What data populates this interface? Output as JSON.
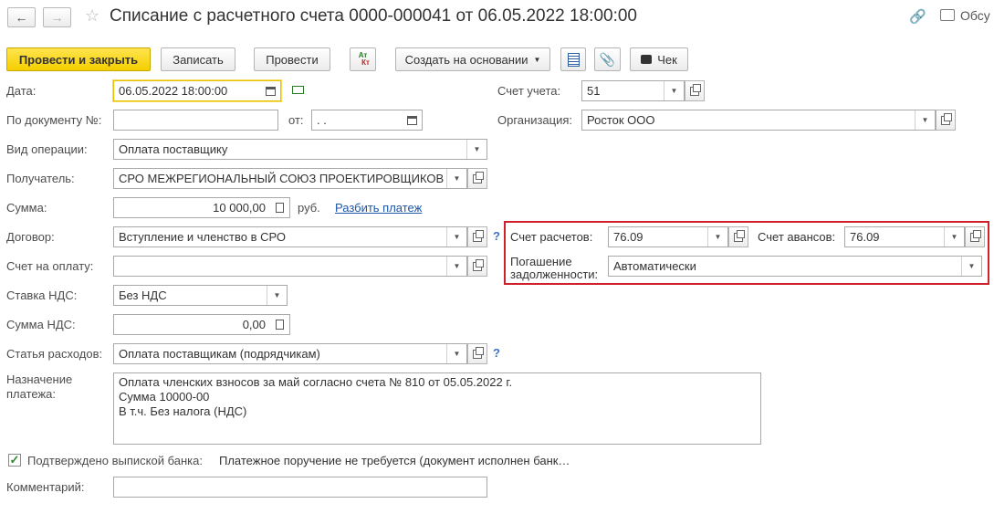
{
  "window": {
    "title": "Списание с расчетного счета 0000-000041 от 06.05.2022 18:00:00",
    "discuss_label": "Обсу"
  },
  "toolbar": {
    "post_close": "Провести и закрыть",
    "save": "Записать",
    "post": "Провести",
    "dtkt_top": "Ат",
    "dtkt_bottom": "Кт",
    "create_based": "Создать на основании",
    "check": "Чек"
  },
  "form": {
    "date_label": "Дата:",
    "date_value": "06.05.2022 18:00:00",
    "doc_no_label": "По документу №:",
    "doc_no_value": "",
    "from_label": "от:",
    "from_value": " .  .",
    "op_type_label": "Вид операции:",
    "op_type_value": "Оплата поставщику",
    "recipient_label": "Получатель:",
    "recipient_value": "СРО МЕЖРЕГИОНАЛЬНЫЙ СОЮЗ ПРОЕКТИРОВЩИКОВ",
    "sum_label": "Сумма:",
    "sum_value": "10 000,00",
    "currency": "руб.",
    "split_link": "Разбить платеж",
    "contract_label": "Договор:",
    "contract_value": "Вступление и членство в СРО",
    "invoice_label": "Счет на оплату:",
    "invoice_value": "",
    "vat_rate_label": "Ставка НДС:",
    "vat_rate_value": "Без НДС",
    "vat_sum_label": "Сумма НДС:",
    "vat_sum_value": "0,00",
    "expense_label": "Статья расходов:",
    "expense_value": "Оплата поставщикам (подрядчикам)",
    "purpose_label_1": "Назначение",
    "purpose_label_2": "платежа:",
    "purpose_value": "Оплата членских взносов за май согласно счета № 810 от 05.05.2022 г.\nСумма 10000-00\nВ т.ч. Без налога (НДС)",
    "confirmed_label": "Подтверждено выпиской банка:",
    "confirmed_checked": true,
    "payment_order_text": "Платежное поручение не требуется (документ исполнен банк…",
    "comment_label": "Комментарий:",
    "comment_value": "",
    "account_label": "Счет учета:",
    "account_value": "51",
    "org_label": "Организация:",
    "org_value": "Росток ООО",
    "settle_account_label": "Счет расчетов:",
    "settle_account_value": "76.09",
    "advance_account_label": "Счет авансов:",
    "advance_account_value": "76.09",
    "debt_repay_label_1": "Погашение",
    "debt_repay_label_2": "задолженности:",
    "debt_repay_value": "Автоматически",
    "help_mark": "?"
  },
  "colors": {
    "primary_button": "#f5cf00",
    "highlight_border": "#d0212a",
    "link": "#1d56a6"
  }
}
